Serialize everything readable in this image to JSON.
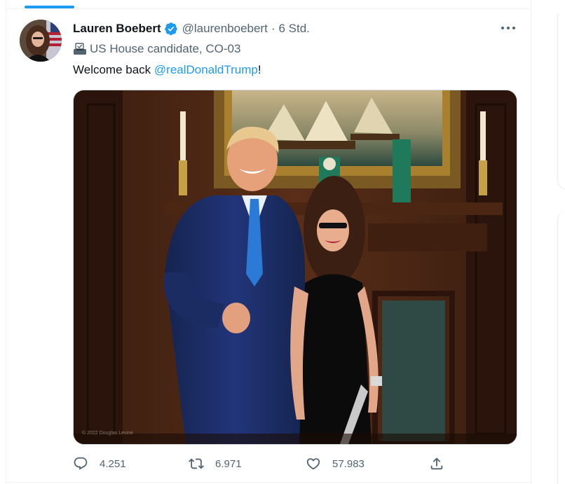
{
  "tweet": {
    "author": {
      "display_name": "Lauren Boebert",
      "handle": "@laurenboebert",
      "verified": true,
      "avatar_icon": "profile-photo"
    },
    "separator": "·",
    "timestamp": "6 Std.",
    "more_icon": "more-horizontal-icon",
    "bio_icon": "ballot-box-icon",
    "bio": "US House candidate, CO-03",
    "text_prefix": "Welcome back ",
    "mention": "@realDonaldTrump",
    "text_suffix": "!",
    "media": {
      "watermark": "© 2022 Douglas Levine"
    },
    "actions": {
      "reply_count": "4.251",
      "retweet_count": "6.971",
      "like_count": "57.983",
      "reply_icon": "reply-icon",
      "retweet_icon": "retweet-icon",
      "like_icon": "heart-icon",
      "share_icon": "share-icon"
    }
  },
  "colors": {
    "accent": "#1d9bf0",
    "text_primary": "#0f1419",
    "text_secondary": "#536471"
  }
}
